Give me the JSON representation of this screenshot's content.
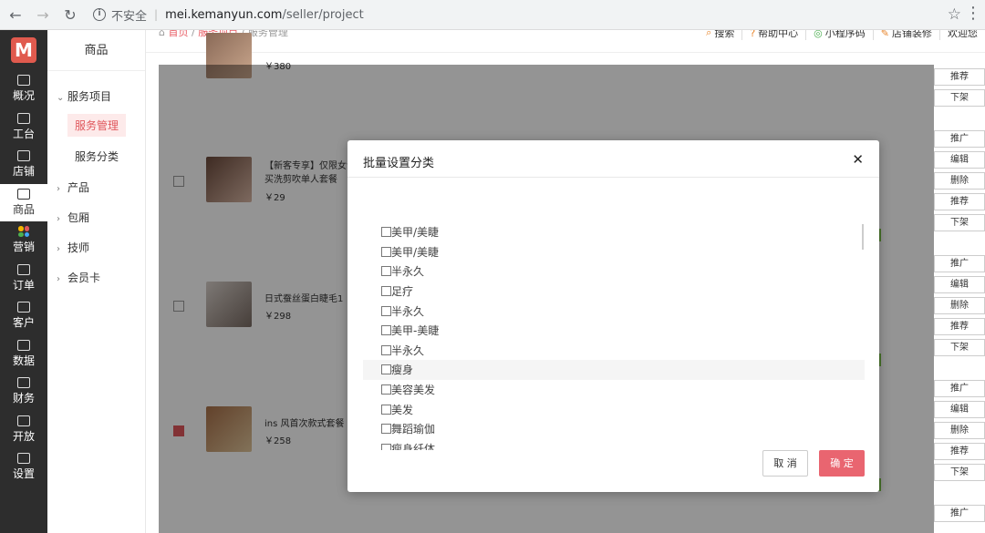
{
  "browser": {
    "insecure_label": "不安全",
    "url_host": "mei.kemanyun.com",
    "url_path": "/seller/project"
  },
  "left_nav": [
    {
      "label": "概况",
      "icon": "chart-icon"
    },
    {
      "label": "工台",
      "icon": "monitor-icon"
    },
    {
      "label": "店铺",
      "icon": "store-icon"
    },
    {
      "label": "商品",
      "icon": "bag-icon",
      "active": true
    },
    {
      "label": "营销",
      "icon": "marketing-icon"
    },
    {
      "label": "订单",
      "icon": "order-icon"
    },
    {
      "label": "客户",
      "icon": "user-icon"
    },
    {
      "label": "数据",
      "icon": "data-icon"
    },
    {
      "label": "财务",
      "icon": "finance-icon"
    },
    {
      "label": "开放",
      "icon": "code-icon"
    },
    {
      "label": "设置",
      "icon": "gear-icon"
    }
  ],
  "sub_nav": {
    "title": "商品",
    "groups": [
      {
        "label": "服务项目",
        "expanded": true
      },
      {
        "label": "产品"
      },
      {
        "label": "包厢"
      },
      {
        "label": "技师"
      },
      {
        "label": "会员卡"
      }
    ],
    "children": [
      {
        "label": "服务管理",
        "active": true
      },
      {
        "label": "服务分类"
      }
    ]
  },
  "breadcrumb": [
    "首页",
    "服务项目",
    "服务管理"
  ],
  "top_links": [
    {
      "label": "搜索",
      "icon": "search-icon"
    },
    {
      "label": "帮助中心",
      "icon": "help-icon"
    },
    {
      "label": "小程序码",
      "icon": "qrcode-icon"
    },
    {
      "label": "店铺装修",
      "icon": "brush-icon"
    },
    {
      "label": "欢迎您"
    }
  ],
  "rows": [
    {
      "name": "",
      "price": "￥380",
      "checked": false,
      "actions": [
        "推荐",
        "下架"
      ]
    },
    {
      "name": "【新客专享】仅限女士 买洗剪吹单人套餐",
      "price": "￥29",
      "checked": false,
      "actions": [
        "推广",
        "编辑",
        "删除",
        "推荐",
        "下架"
      ]
    },
    {
      "name": "日式蚕丝蛋白睫毛1",
      "price": "￥298",
      "checked": false,
      "actions": [
        "推广",
        "编辑",
        "删除",
        "推荐",
        "下架"
      ]
    },
    {
      "name": "ins 风首次款式套餐",
      "price": "￥258",
      "checked": true,
      "actions": [
        "推广",
        "编辑",
        "删除",
        "推荐",
        "下架"
      ]
    },
    {
      "name": "",
      "price": "",
      "checked": false,
      "actions": [
        "推广"
      ]
    }
  ],
  "dialog": {
    "title": "批量设置分类",
    "options": [
      "美甲/美睫",
      "美甲/美睫",
      "半永久",
      "足疗",
      "半永久",
      "美甲-美睫",
      "半永久",
      "瘦身",
      "美容美发",
      "美发",
      "舞蹈瑜伽",
      "瘦身纤体"
    ],
    "cancel_label": "取 消",
    "ok_label": "确 定"
  },
  "colors": {
    "accent": "#e96570",
    "sidebar": "#2d2d2d",
    "logo": "#e05a4e"
  }
}
